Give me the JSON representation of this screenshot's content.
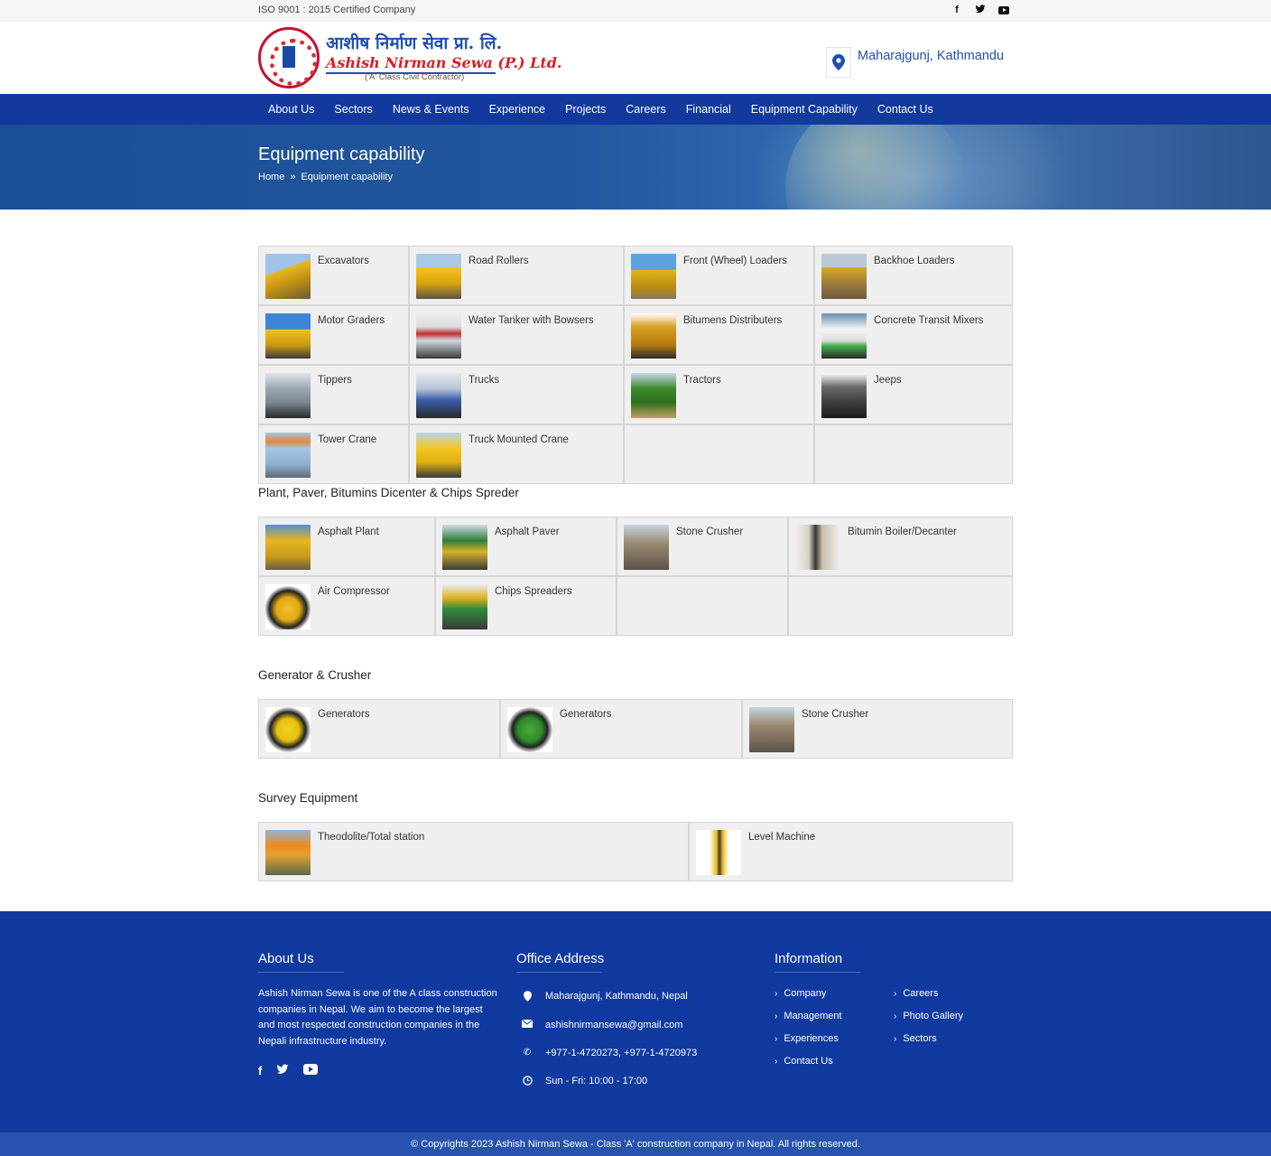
{
  "topbar": {
    "cert": "ISO 9001 : 2015 Certified Company",
    "social": [
      "facebook-icon",
      "twitter-icon",
      "youtube-icon"
    ]
  },
  "header": {
    "logo_np": "आशीष निर्माण सेवा प्रा. लि.",
    "logo_en": "Ashish Nirman Sewa (P.) Ltd.",
    "logo_sub": "('A' Class Civil Contractor)",
    "location": "Maharajgunj, Kathmandu"
  },
  "nav": [
    "About Us",
    "Sectors",
    "News & Events",
    "Experience",
    "Projects",
    "Careers",
    "Financial",
    "Equipment Capability",
    "Contact Us"
  ],
  "banner": {
    "title": "Equipment capability",
    "crumb_home": "Home",
    "crumb_current": "Equipment capability"
  },
  "sections": {
    "main": [
      "Excavators",
      "Road Rollers",
      "Front (Wheel) Loaders",
      "Backhoe Loaders",
      "Motor Graders",
      "Water Tanker with Bowsers",
      "Bitumens Distributers",
      "Concrete Transit Mixers",
      "Tippers",
      "Trucks",
      "Tractors",
      "Jeeps",
      "Tower Crane",
      "Truck Mounted Crane"
    ],
    "plant_title": "Plant, Paver, Bitumins Dicenter & Chips Spreder",
    "plant": [
      "Asphalt Plant",
      "Asphalt Paver",
      "Stone Crusher",
      "Bitumin Boiler/Decanter",
      "Air Compressor",
      "Chips Spreaders"
    ],
    "generator_title": "Generator & Crusher",
    "generator": [
      "Generators",
      "Generators",
      "Stone Crusher"
    ],
    "survey_title": "Survey Equipment",
    "survey": [
      "Theodolite/Total station",
      "Level Machine"
    ]
  },
  "footer": {
    "about_title": "About Us",
    "about_text": "Ashish Nirman Sewa is one of the A class construction companies in Nepal. We aim to become the largest and most respected construction companies in the Nepali infrastructure industry.",
    "office_title": "Office Address",
    "address": "Maharajgunj, Kathmandu, Nepal",
    "email": "ashishnirmansewa@gmail.com",
    "phone": "+977-1-4720273, +977-1-4720973",
    "hours": "Sun - Fri: 10:00 - 17:00",
    "info_title": "Information",
    "info_left": [
      "Company",
      "Management",
      "Experiences",
      "Contact Us"
    ],
    "info_right": [
      "Careers",
      "Photo Gallery",
      "Sectors"
    ]
  },
  "copyright": "© Copyrights 2023 Ashish Nirman Sewa - Class 'A' construction company in Nepal. All rights reserved.",
  "colors": {
    "nav": "#12399e",
    "footer": "#103a9f",
    "accent": "#1e4fb4",
    "copyright_bar": "#2752ad"
  }
}
